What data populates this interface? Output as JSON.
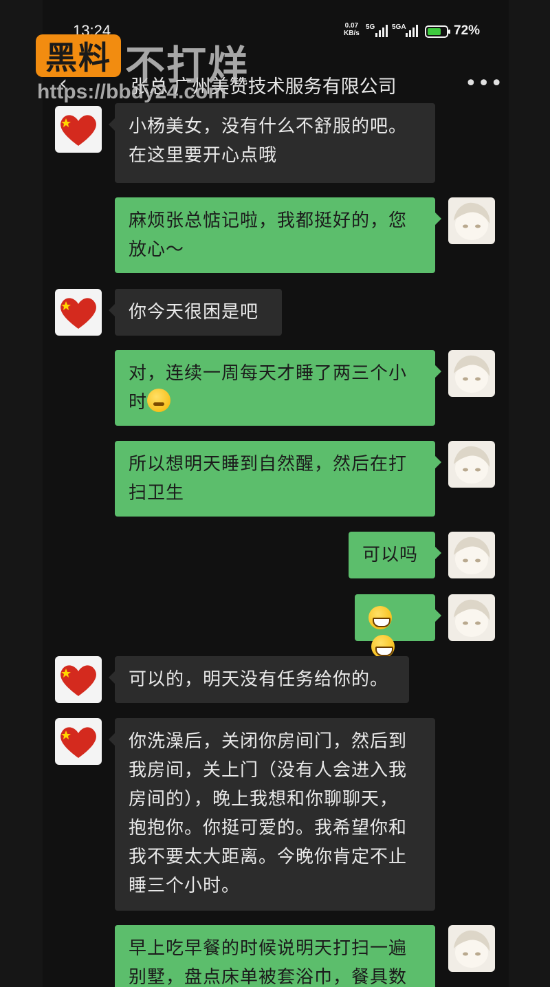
{
  "status_bar": {
    "time": "13:24",
    "net_speed": "0.07",
    "net_unit": "KB/s",
    "sim1": "5G",
    "sim2": "5GA",
    "battery_level": 0.72,
    "battery_text": "72%"
  },
  "watermark": {
    "badge": "黑料",
    "text": "不打烊",
    "url": "https://bbdy24.com"
  },
  "header": {
    "back_icon": "chevron-left-icon",
    "title": "张总 广州美赞技术服务有限公司",
    "more_icon": "more-dots-icon",
    "more_label": "•••"
  },
  "messages": [
    {
      "sender": "other",
      "text": [
        "小杨美女，没有什么不舒服的吧。",
        "在这里要开心点哦"
      ]
    },
    {
      "sender": "me",
      "text": [
        "麻烦张总惦记啦，我都挺好的，您",
        "放心～"
      ]
    },
    {
      "sender": "other",
      "text": [
        "你今天很困是吧"
      ]
    },
    {
      "sender": "me",
      "text": [
        "对，连续一周每天才睡了两三个小",
        "时"
      ],
      "emoji": "crying-face"
    },
    {
      "sender": "me",
      "text": [
        "所以想明天睡到自然醒，然后在打",
        "扫卫生"
      ]
    },
    {
      "sender": "me",
      "text": [
        "可以吗"
      ]
    },
    {
      "sender": "me",
      "text": [],
      "emoji": "grinning-face x2"
    },
    {
      "sender": "other",
      "text": [
        "可以的，明天没有任务给你的。"
      ]
    },
    {
      "sender": "other",
      "text": [
        "你洗澡后，关闭你房间门，然后到",
        "我房间，关上门（没有人会进入我",
        "房间的），晚上我想和你聊聊天，",
        "抱抱你。你挺可爱的。我希望你和",
        "我不要太大距离。今晚你肯定不止",
        "睡三个小时。"
      ]
    },
    {
      "sender": "me",
      "text": [
        "早上吃早餐的时候说明天打扫一遍",
        "别墅，盘点床单被套浴巾，餐具数"
      ]
    }
  ],
  "colors": {
    "background": "#111111",
    "incoming_bubble": "#2c2c2c",
    "outgoing_bubble": "#5cbe6c",
    "watermark_badge": "#f28c10"
  },
  "icons": {
    "boss_avatar": "china-flag-heart-icon",
    "my_avatar": "anime-girl-avatar-icon"
  }
}
